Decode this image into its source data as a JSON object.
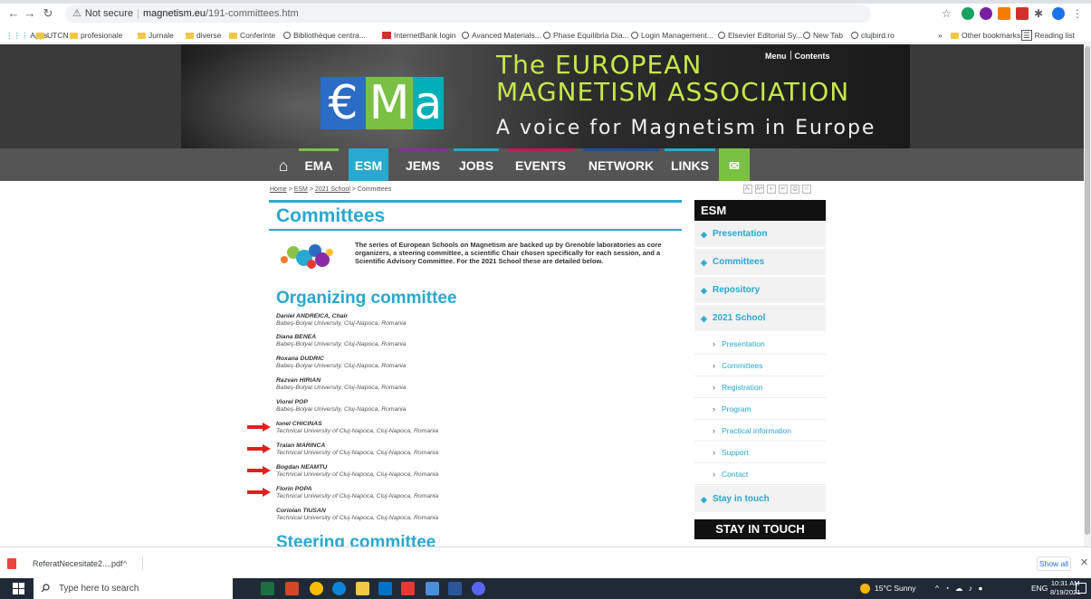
{
  "browser": {
    "url_warning": "Not secure",
    "url_host": "magnetism.eu",
    "url_path": "/191-committees.htm",
    "bookmarks": [
      "Apps",
      "UTCN",
      "profesionale",
      "Jurnale",
      "diverse",
      "Conferinte",
      "Bibliothèque centra...",
      "InternetBank login",
      "Avanced Materials...",
      "Phase Equilibria Dia...",
      "Login Management...",
      "Elsevier Editorial Sy...",
      "New Tab",
      "clujbird.ro"
    ],
    "other_bookmarks": "Other bookmarks",
    "reading_list": "Reading list"
  },
  "banner": {
    "logo_e": "€",
    "logo_m": "M",
    "logo_a": "a",
    "title_line1": "The EUROPEAN",
    "title_line2": "MAGNETISM ASSOCIATION",
    "subtitle": "A voice for Magnetism in Europe",
    "menu": "Menu",
    "contents": "Contents"
  },
  "nav": {
    "items": [
      {
        "label": "EMA",
        "color": "#7ac143"
      },
      {
        "label": "ESM",
        "color": "#29a8d0"
      },
      {
        "label": "JEMS",
        "color": "#8c2ca1"
      },
      {
        "label": "JOBS",
        "color": "#29a8d0"
      },
      {
        "label": "EVENTS",
        "color": "#c2185b"
      },
      {
        "label": "NETWORK",
        "color": "#1f4e9c"
      },
      {
        "label": "LINKS",
        "color": "#29a8d0"
      }
    ]
  },
  "breadcrumb": {
    "home": "Home",
    "esm": "ESM",
    "school": "2021 School",
    "current": "Committees",
    "separator": ">"
  },
  "tools": [
    "A-",
    "A+",
    "◐",
    "↵",
    "⎙",
    "☆"
  ],
  "main": {
    "title": "Committees",
    "intro": "The series of European Schools on Magnetism are backed up by Grenoble laboratories as core organizers, a steering committee, a scientific Chair chosen specifically for each session, and a Scientific Advisory Committee. For the 2021 School these are detailed below.",
    "organizing_title": "Organizing committee",
    "members": [
      {
        "name": "Daniel ANDREICA, Chair",
        "aff": "Babeş-Bolyai University, Cluj-Napoca, Romania",
        "arrow": false
      },
      {
        "name": "Diana BENEA",
        "aff": "Babeş-Bolyai University, Cluj-Napoca, Romania",
        "arrow": false
      },
      {
        "name": "Roxana DUDRIC",
        "aff": "Babeş-Bolyai University, Cluj-Napoca, Romania",
        "arrow": false
      },
      {
        "name": "Razvan HIRIAN",
        "aff": "Babeş-Bolyai University, Cluj-Napoca, Romania",
        "arrow": false
      },
      {
        "name": "Viorel POP",
        "aff": "Babeş-Bolyai University, Cluj-Napoca, Romania",
        "arrow": false
      },
      {
        "name": "Ionel CHICINAS",
        "aff": "Technical University of Cluj-Napoca, Cluj-Napoca, Romania",
        "arrow": true
      },
      {
        "name": "Traian MARINCA",
        "aff": "Technical University of Cluj-Napoca, Cluj-Napoca, Romania",
        "arrow": true
      },
      {
        "name": "Bogdan NEAMTU",
        "aff": "Technical University of Cluj-Napoca, Cluj-Napoca, Romania",
        "arrow": true
      },
      {
        "name": "Florin POPA",
        "aff": "Technical University of Cluj-Napoca, Cluj-Napoca, Romania",
        "arrow": true
      },
      {
        "name": "Coriolan TIUSAN",
        "aff": "Technical University of Cluj-Napoca, Cluj-Napoca, Romania",
        "arrow": false
      }
    ],
    "steering_title": "Steering committee"
  },
  "sidebar": {
    "head": "ESM",
    "items": [
      "Presentation",
      "Committees",
      "Repository",
      "2021 School"
    ],
    "subitems": [
      "Presentation",
      "Committees",
      "Registration",
      "Program",
      "Practical information",
      "Support",
      "Contact"
    ],
    "stay": "Stay in touch",
    "stay_head": "STAY IN TOUCH"
  },
  "downloads": {
    "file": "ReferatNecesitate2....pdf",
    "show_all": "Show all"
  },
  "taskbar": {
    "search_placeholder": "Type here to search",
    "weather": "15°C Sunny",
    "lang": "ENG",
    "time": "10:31 AM",
    "date": "8/19/2021"
  }
}
